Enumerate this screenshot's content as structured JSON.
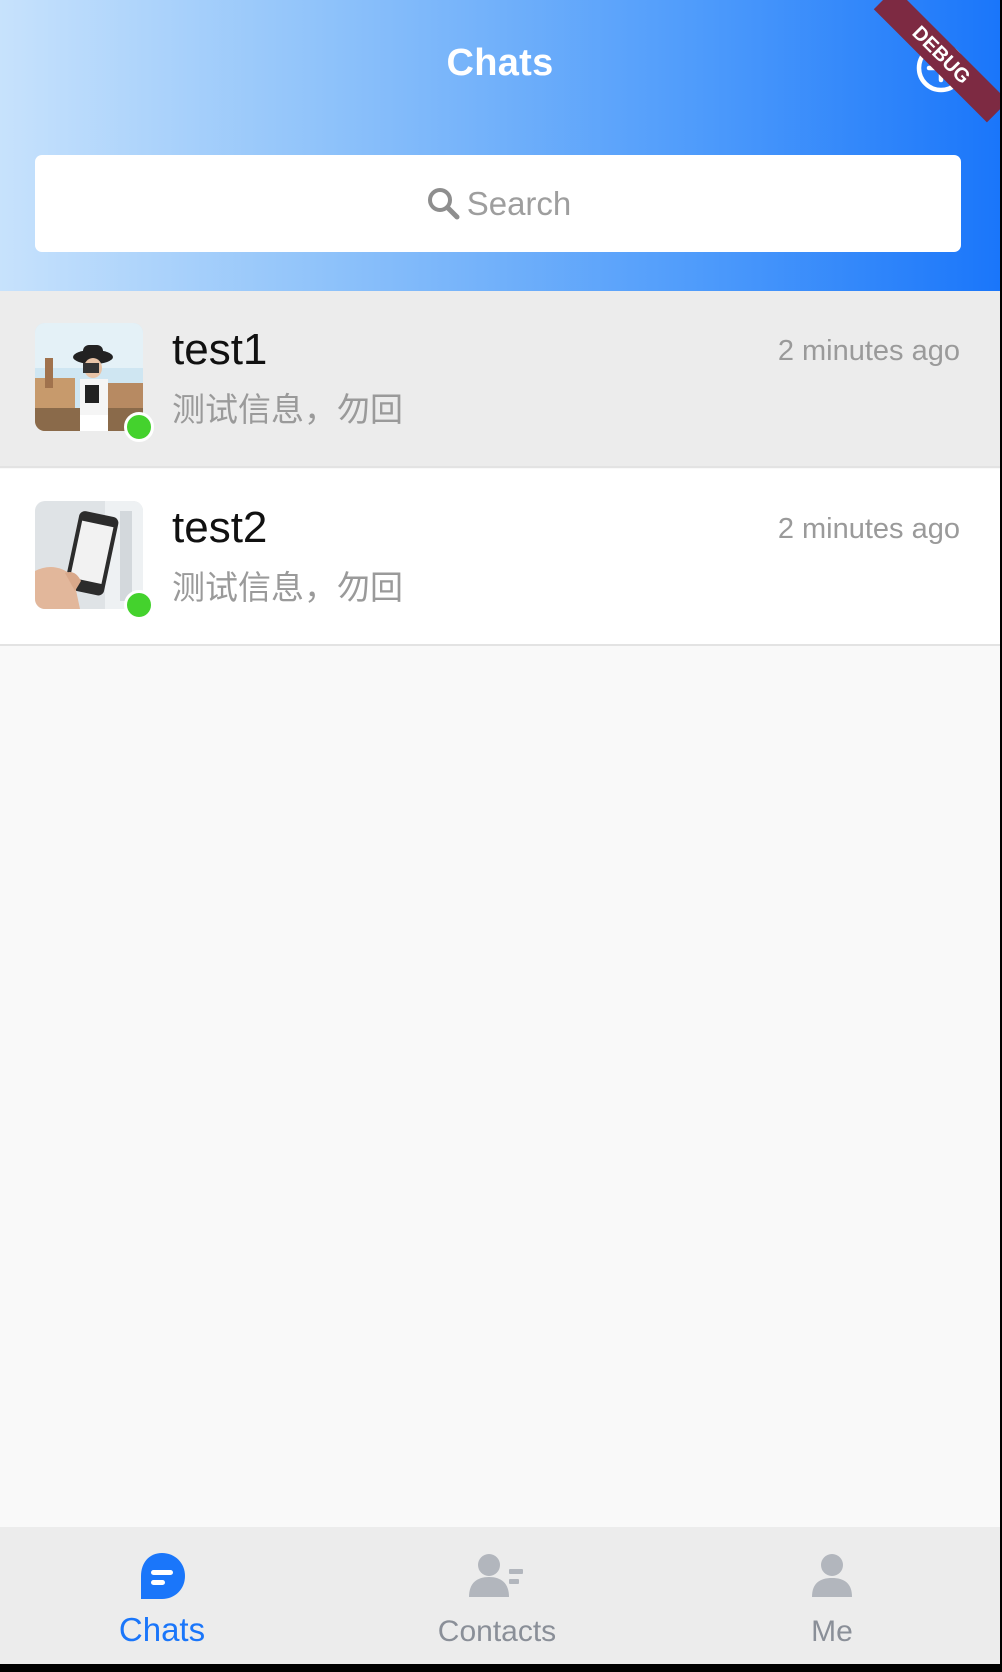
{
  "header": {
    "title": "Chats",
    "add_icon": "plus-circle-icon",
    "debug_banner": "DEBUG"
  },
  "search": {
    "placeholder": "Search",
    "icon": "search-icon"
  },
  "chats": [
    {
      "name": "test1",
      "time": "2 minutes ago",
      "message": "测试信息，勿回",
      "online": true,
      "highlighted": true,
      "avatar": "woman-with-camera-photo"
    },
    {
      "name": "test2",
      "time": "2 minutes ago",
      "message": "测试信息，勿回",
      "online": true,
      "highlighted": false,
      "avatar": "hand-holding-phone-photo"
    }
  ],
  "tabs": [
    {
      "label": "Chats",
      "icon": "chat-bubble-icon",
      "active": true
    },
    {
      "label": "Contacts",
      "icon": "contacts-icon",
      "active": false
    },
    {
      "label": "Me",
      "icon": "person-icon",
      "active": false
    }
  ],
  "colors": {
    "accent": "#1a76fa",
    "online": "#44d22d",
    "debug_ribbon": "#7d2a42",
    "inactive_tab": "#8a8f98"
  }
}
